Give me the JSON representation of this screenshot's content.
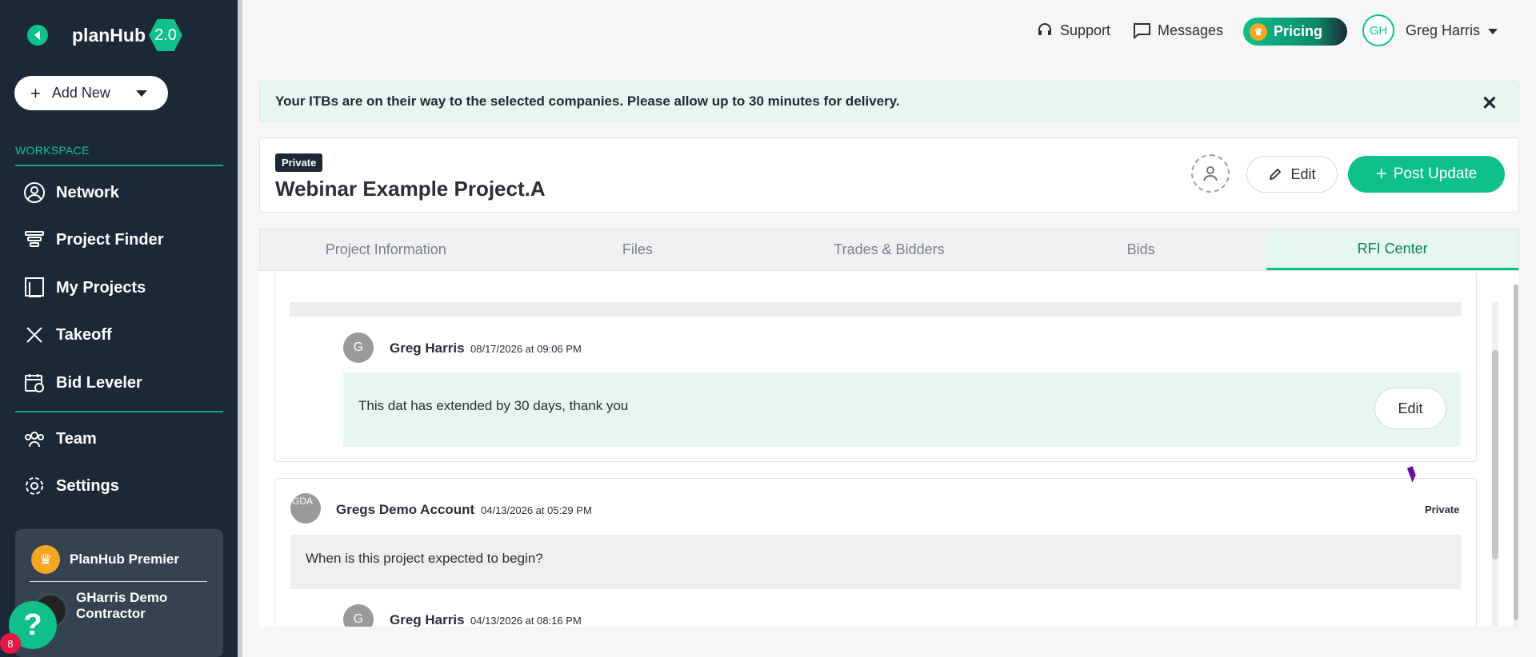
{
  "sidebar": {
    "logo": "planHub",
    "version": "2.0",
    "add_new": "Add New",
    "section": "WORKSPACE",
    "items": [
      {
        "label": "Network"
      },
      {
        "label": "Project Finder"
      },
      {
        "label": "My Projects"
      },
      {
        "label": "Takeoff"
      },
      {
        "label": "Bid Leveler"
      },
      {
        "label": "Team"
      },
      {
        "label": "Settings"
      }
    ],
    "premier": "PlanHub Premier",
    "company": "GHarris Demo Contractor",
    "help": "?",
    "help_count": "8"
  },
  "topbar": {
    "support": "Support",
    "messages": "Messages",
    "pricing": "Pricing",
    "avatar": "GH",
    "user_name": "Greg Harris"
  },
  "banner": {
    "text": "Your ITBs are on their way to the selected companies. Please allow up to 30 minutes for delivery."
  },
  "project": {
    "tag": "Private",
    "title": "Webinar Example Project.A",
    "edit": "Edit",
    "post_update": "Post Update"
  },
  "tabs": [
    {
      "label": "Project Information"
    },
    {
      "label": "Files"
    },
    {
      "label": "Trades & Bidders"
    },
    {
      "label": "Bids"
    },
    {
      "label": "RFI Center"
    }
  ],
  "rfi": {
    "reply1": {
      "avatar": "G",
      "name": "Greg Harris",
      "date": "08/17/2026 at 09:06 PM",
      "text": "This dat has extended by 30 days, thank you",
      "edit": "Edit"
    },
    "question2": {
      "avatar": "GDA",
      "name": "Gregs Demo Account",
      "date": "04/13/2026 at 05:29 PM",
      "visibility": "Private",
      "text": "When is this project expected to begin?"
    },
    "reply2": {
      "avatar": "G",
      "name": "Greg Harris",
      "date": "04/13/2026 at 08:16 PM"
    }
  },
  "colors": {
    "brand_green": "#0fc08b",
    "sidebar_bg": "#1b2835",
    "banner_bg": "#e6f7f0"
  }
}
